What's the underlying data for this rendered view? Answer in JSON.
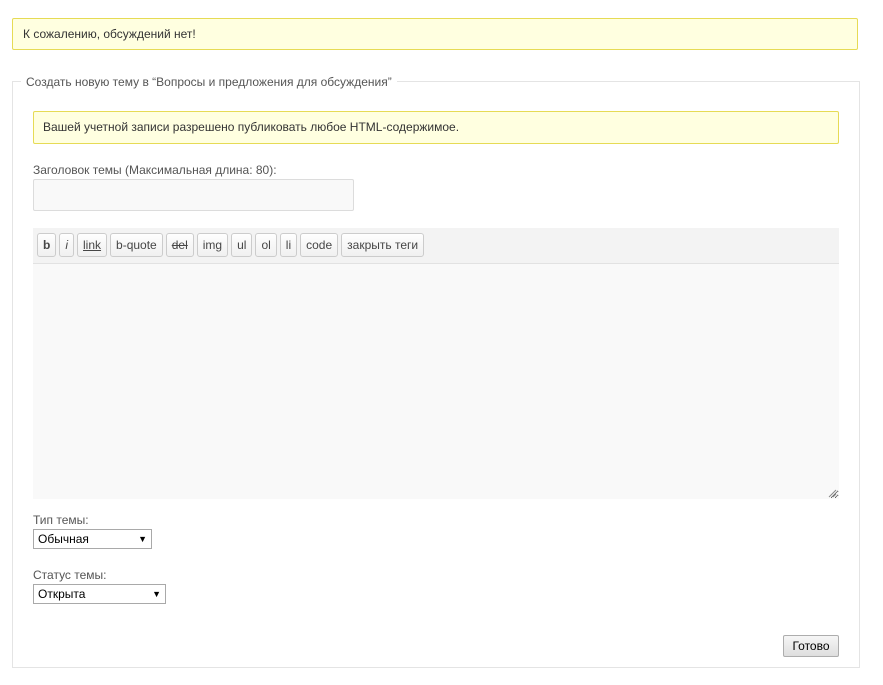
{
  "notices": {
    "no_discussions": "К сожалению, обсуждений нет!",
    "html_allowed": "Вашей учетной записи разрешено публиковать любое HTML-содержимое."
  },
  "form": {
    "legend": "Создать новую тему в “Вопросы и предложения для обсуждения”",
    "title_label": "Заголовок темы (Максимальная длина: 80):",
    "title_value": "",
    "toolbar": {
      "bold": "b",
      "italic": "i",
      "link": "link",
      "bquote": "b-quote",
      "del": "del",
      "img": "img",
      "ul": "ul",
      "ol": "ol",
      "li": "li",
      "code": "code",
      "close_tags": "закрыть теги"
    },
    "content_value": "",
    "type_label": "Тип темы:",
    "type_selected": "Обычная",
    "status_label": "Статус темы:",
    "status_selected": "Открыта",
    "submit_label": "Готово"
  },
  "icons": {
    "select_arrow": "dropdown-arrow-icon",
    "resize": "resize-grip-icon"
  },
  "colors": {
    "notice_bg": "#ffffe0",
    "notice_border": "#e6db55",
    "field_bg": "#f9f9f9"
  }
}
